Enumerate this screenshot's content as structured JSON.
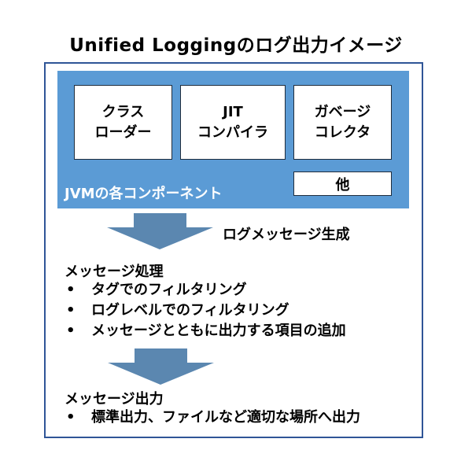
{
  "title": "Unified Loggingのログ出力イメージ",
  "jvm_panel": {
    "label": "JVMの各コンポーネント",
    "components": [
      {
        "line1": "クラス",
        "line2": "ローダー"
      },
      {
        "line1": "JIT",
        "line2": "コンパイラ"
      },
      {
        "line1": "ガベージ",
        "line2": "コレクタ"
      }
    ],
    "other": "他"
  },
  "arrow1_label": "ログメッセージ生成",
  "processing": {
    "heading": "メッセージ処理",
    "bullet": "•",
    "items": [
      "タグでのフィルタリング",
      "ログレベルでのフィルタリング",
      "メッセージとともに出力する項目の追加"
    ]
  },
  "output": {
    "heading": "メッセージ出力",
    "bullet": "•",
    "items": [
      "標準出力、ファイルなど適切な場所へ出力"
    ]
  },
  "colors": {
    "frame_border": "#2F5597",
    "panel_fill": "#5B9BD5",
    "arrow_fill": "#5B87B0"
  }
}
